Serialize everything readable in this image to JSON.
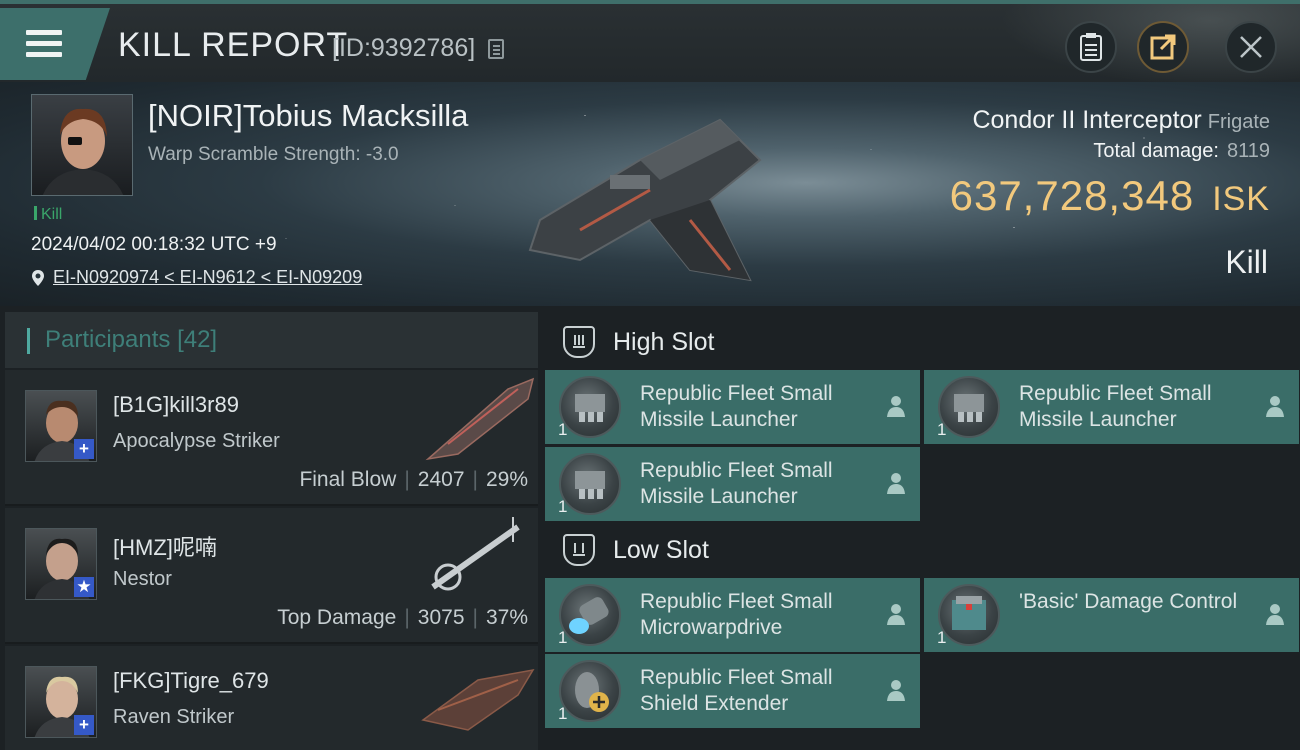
{
  "header": {
    "title": "KILL REPORT",
    "id_label": "[ID:9392786]"
  },
  "victim": {
    "name": "[NOIR]Tobius Macksilla",
    "warp_scramble": "Warp Scramble Strength: -3.0",
    "tag": "Kill",
    "datetime": "2024/04/02 00:18:32 UTC +9",
    "route": "EI-N0920974 < EI-N9612 < EI-N09209",
    "ship": "Condor II Interceptor",
    "ship_class": "Frigate",
    "total_damage_label": "Total damage:",
    "total_damage": "8119",
    "isk_value": "637,728,348",
    "isk_unit": "ISK",
    "result": "Kill"
  },
  "participants": {
    "label": "Participants",
    "count": "[42]",
    "items": [
      {
        "name": "[B1G]kill3r89",
        "ship": "Apocalypse Striker",
        "role": "Final Blow",
        "damage": "2407",
        "pct": "29%",
        "badge": "+"
      },
      {
        "name": "[HMZ]呢喃",
        "ship": "Nestor",
        "role": "Top Damage",
        "damage": "3075",
        "pct": "37%",
        "badge": "★"
      },
      {
        "name": "[FKG]Tigre_679",
        "ship": "Raven Striker",
        "role": "",
        "damage": "",
        "pct": "",
        "badge": "+"
      }
    ]
  },
  "slots": {
    "high_label": "High Slot",
    "low_label": "Low Slot",
    "high": [
      {
        "name": "Republic Fleet Small Missile Launcher",
        "qty": "1",
        "icon": "missile-launcher-icon"
      },
      {
        "name": "Republic Fleet Small Missile Launcher",
        "qty": "1",
        "icon": "missile-launcher-icon"
      },
      {
        "name": "Republic Fleet Small Missile Launcher",
        "qty": "1",
        "icon": "missile-launcher-icon"
      }
    ],
    "low": [
      {
        "name": "Republic Fleet Small Microwarpdrive",
        "qty": "1",
        "icon": "microwarpdrive-icon"
      },
      {
        "name": "'Basic' Damage Control",
        "qty": "1",
        "icon": "damage-control-icon"
      },
      {
        "name": "Republic Fleet Small Shield Extender",
        "qty": "1",
        "icon": "shield-extender-icon"
      }
    ]
  },
  "colors": {
    "accent": "#3a6d68",
    "isk": "#f2c97d",
    "kill_tag": "#3aa66a",
    "badge": "#3559c7"
  }
}
